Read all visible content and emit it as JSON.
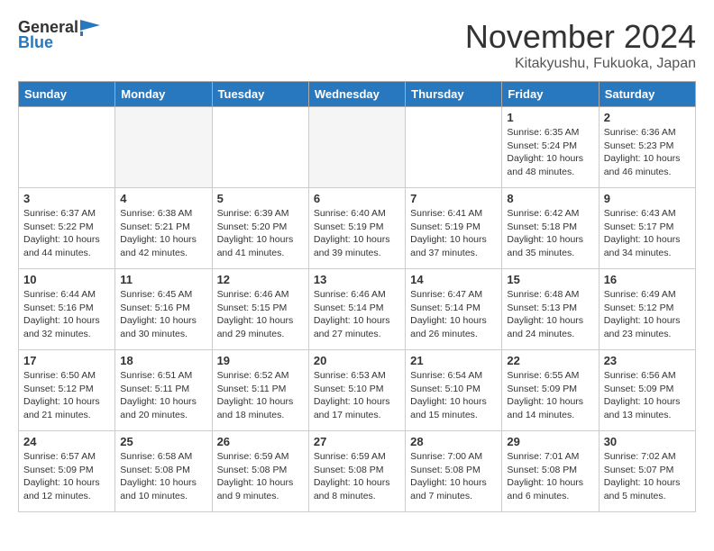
{
  "logo": {
    "general": "General",
    "blue": "Blue"
  },
  "title": "November 2024",
  "subtitle": "Kitakyushu, Fukuoka, Japan",
  "days_of_week": [
    "Sunday",
    "Monday",
    "Tuesday",
    "Wednesday",
    "Thursday",
    "Friday",
    "Saturday"
  ],
  "weeks": [
    [
      {
        "day": "",
        "info": ""
      },
      {
        "day": "",
        "info": ""
      },
      {
        "day": "",
        "info": ""
      },
      {
        "day": "",
        "info": ""
      },
      {
        "day": "",
        "info": ""
      },
      {
        "day": "1",
        "info": "Sunrise: 6:35 AM\nSunset: 5:24 PM\nDaylight: 10 hours and 48 minutes."
      },
      {
        "day": "2",
        "info": "Sunrise: 6:36 AM\nSunset: 5:23 PM\nDaylight: 10 hours and 46 minutes."
      }
    ],
    [
      {
        "day": "3",
        "info": "Sunrise: 6:37 AM\nSunset: 5:22 PM\nDaylight: 10 hours and 44 minutes."
      },
      {
        "day": "4",
        "info": "Sunrise: 6:38 AM\nSunset: 5:21 PM\nDaylight: 10 hours and 42 minutes."
      },
      {
        "day": "5",
        "info": "Sunrise: 6:39 AM\nSunset: 5:20 PM\nDaylight: 10 hours and 41 minutes."
      },
      {
        "day": "6",
        "info": "Sunrise: 6:40 AM\nSunset: 5:19 PM\nDaylight: 10 hours and 39 minutes."
      },
      {
        "day": "7",
        "info": "Sunrise: 6:41 AM\nSunset: 5:19 PM\nDaylight: 10 hours and 37 minutes."
      },
      {
        "day": "8",
        "info": "Sunrise: 6:42 AM\nSunset: 5:18 PM\nDaylight: 10 hours and 35 minutes."
      },
      {
        "day": "9",
        "info": "Sunrise: 6:43 AM\nSunset: 5:17 PM\nDaylight: 10 hours and 34 minutes."
      }
    ],
    [
      {
        "day": "10",
        "info": "Sunrise: 6:44 AM\nSunset: 5:16 PM\nDaylight: 10 hours and 32 minutes."
      },
      {
        "day": "11",
        "info": "Sunrise: 6:45 AM\nSunset: 5:16 PM\nDaylight: 10 hours and 30 minutes."
      },
      {
        "day": "12",
        "info": "Sunrise: 6:46 AM\nSunset: 5:15 PM\nDaylight: 10 hours and 29 minutes."
      },
      {
        "day": "13",
        "info": "Sunrise: 6:46 AM\nSunset: 5:14 PM\nDaylight: 10 hours and 27 minutes."
      },
      {
        "day": "14",
        "info": "Sunrise: 6:47 AM\nSunset: 5:14 PM\nDaylight: 10 hours and 26 minutes."
      },
      {
        "day": "15",
        "info": "Sunrise: 6:48 AM\nSunset: 5:13 PM\nDaylight: 10 hours and 24 minutes."
      },
      {
        "day": "16",
        "info": "Sunrise: 6:49 AM\nSunset: 5:12 PM\nDaylight: 10 hours and 23 minutes."
      }
    ],
    [
      {
        "day": "17",
        "info": "Sunrise: 6:50 AM\nSunset: 5:12 PM\nDaylight: 10 hours and 21 minutes."
      },
      {
        "day": "18",
        "info": "Sunrise: 6:51 AM\nSunset: 5:11 PM\nDaylight: 10 hours and 20 minutes."
      },
      {
        "day": "19",
        "info": "Sunrise: 6:52 AM\nSunset: 5:11 PM\nDaylight: 10 hours and 18 minutes."
      },
      {
        "day": "20",
        "info": "Sunrise: 6:53 AM\nSunset: 5:10 PM\nDaylight: 10 hours and 17 minutes."
      },
      {
        "day": "21",
        "info": "Sunrise: 6:54 AM\nSunset: 5:10 PM\nDaylight: 10 hours and 15 minutes."
      },
      {
        "day": "22",
        "info": "Sunrise: 6:55 AM\nSunset: 5:09 PM\nDaylight: 10 hours and 14 minutes."
      },
      {
        "day": "23",
        "info": "Sunrise: 6:56 AM\nSunset: 5:09 PM\nDaylight: 10 hours and 13 minutes."
      }
    ],
    [
      {
        "day": "24",
        "info": "Sunrise: 6:57 AM\nSunset: 5:09 PM\nDaylight: 10 hours and 12 minutes."
      },
      {
        "day": "25",
        "info": "Sunrise: 6:58 AM\nSunset: 5:08 PM\nDaylight: 10 hours and 10 minutes."
      },
      {
        "day": "26",
        "info": "Sunrise: 6:59 AM\nSunset: 5:08 PM\nDaylight: 10 hours and 9 minutes."
      },
      {
        "day": "27",
        "info": "Sunrise: 6:59 AM\nSunset: 5:08 PM\nDaylight: 10 hours and 8 minutes."
      },
      {
        "day": "28",
        "info": "Sunrise: 7:00 AM\nSunset: 5:08 PM\nDaylight: 10 hours and 7 minutes."
      },
      {
        "day": "29",
        "info": "Sunrise: 7:01 AM\nSunset: 5:08 PM\nDaylight: 10 hours and 6 minutes."
      },
      {
        "day": "30",
        "info": "Sunrise: 7:02 AM\nSunset: 5:07 PM\nDaylight: 10 hours and 5 minutes."
      }
    ]
  ]
}
